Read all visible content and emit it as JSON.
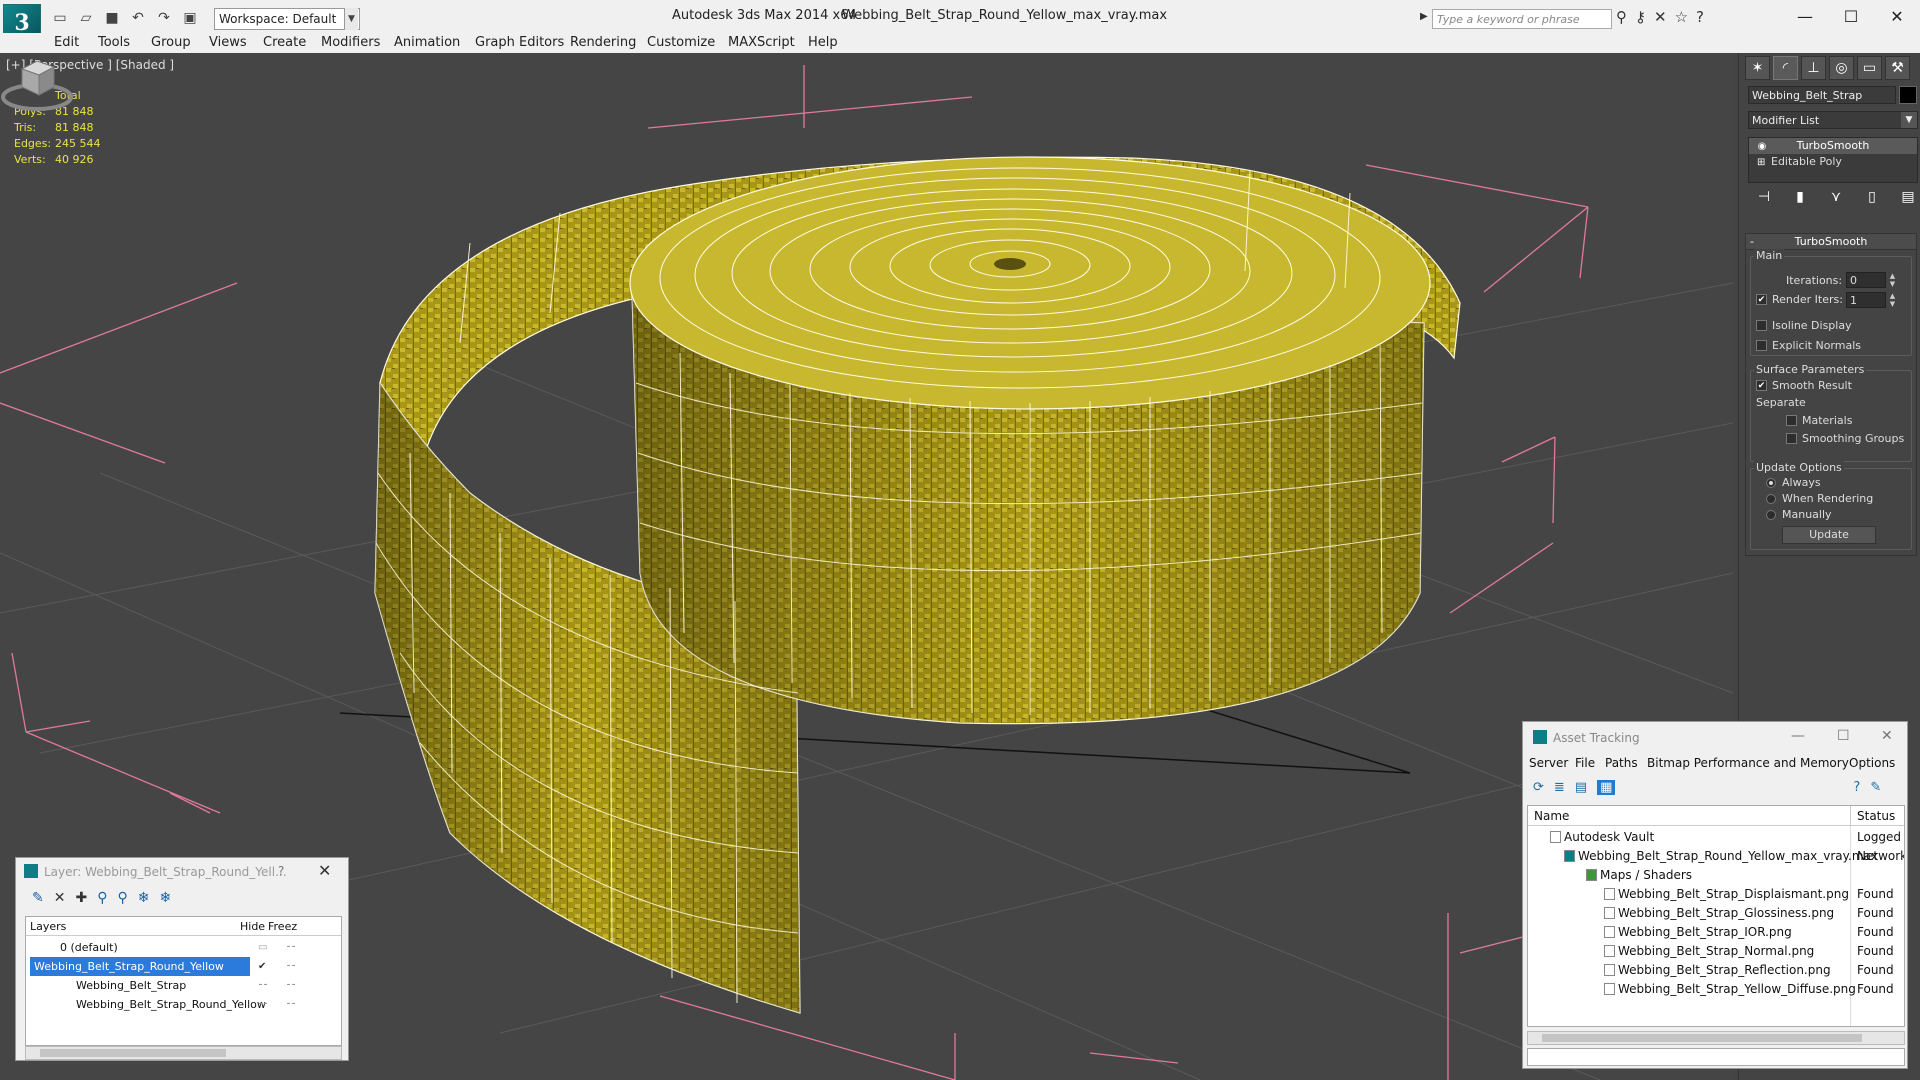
{
  "titlebar": {
    "app_title": "Autodesk 3ds Max  2014 x64",
    "file_title": "Webbing_Belt_Strap_Round_Yellow_max_vray.max",
    "workspace": "Workspace: Default",
    "search_placeholder": "Type a keyword or phrase"
  },
  "menu": [
    "Edit",
    "Tools",
    "Group",
    "Views",
    "Create",
    "Modifiers",
    "Animation",
    "Graph Editors",
    "Rendering",
    "Customize",
    "MAXScript",
    "Help"
  ],
  "viewport": {
    "label": "[+] [Perspective ] [Shaded ]",
    "stats": {
      "header": "Total",
      "rows": [
        {
          "k": "Polys:",
          "v": "81 848"
        },
        {
          "k": "Tris:",
          "v": "81 848"
        },
        {
          "k": "Edges:",
          "v": "245 544"
        },
        {
          "k": "Verts:",
          "v": "40 926"
        }
      ]
    },
    "colors": {
      "background": "#454545",
      "grid": "#5c5c5c",
      "bbox": "#e07a9a",
      "mesh": "#b5a51a",
      "wire": "#fffbe0"
    }
  },
  "command_panel": {
    "object_name": "Webbing_Belt_Strap",
    "modifier_list": "Modifier List",
    "stack": [
      "TurboSmooth",
      "Editable Poly"
    ],
    "turbosmooth": {
      "title": "TurboSmooth",
      "main_group": "Main",
      "iterations_label": "Iterations:",
      "iterations": "0",
      "render_iters_label": "Render Iters:",
      "render_iters": "1",
      "render_iters_checked": true,
      "isoline": "Isoline Display",
      "explicit_normals": "Explicit Normals",
      "surface_group": "Surface Parameters",
      "smooth_result": "Smooth Result",
      "smooth_result_checked": true,
      "separate": "Separate",
      "materials": "Materials",
      "smoothing_groups": "Smoothing Groups",
      "update_group": "Update Options",
      "always": "Always",
      "when_rendering": "When Rendering",
      "manually": "Manually",
      "update_button": "Update"
    }
  },
  "layer_window": {
    "title": "Layer: Webbing_Belt_Strap_Round_Yell...",
    "help": "?",
    "columns": [
      "Layers",
      "Hide",
      "Freez"
    ],
    "rows": [
      {
        "name": "0 (default)",
        "indent": 0,
        "selected": false
      },
      {
        "name": "Webbing_Belt_Strap_Round_Yellow",
        "indent": 0,
        "selected": true
      },
      {
        "name": "Webbing_Belt_Strap",
        "indent": 1,
        "selected": false
      },
      {
        "name": "Webbing_Belt_Strap_Round_Yellow",
        "indent": 1,
        "selected": false
      }
    ]
  },
  "asset_window": {
    "title": "Asset Tracking",
    "menu": [
      "Server",
      "File",
      "Paths",
      "Bitmap Performance and Memory",
      "Options"
    ],
    "columns": [
      "Name",
      "Status"
    ],
    "rows": [
      {
        "name": "Autodesk Vault",
        "status": "Logged O",
        "indent": 1
      },
      {
        "name": "Webbing_Belt_Strap_Round_Yellow_max_vray.max",
        "status": "Network",
        "indent": 2
      },
      {
        "name": "Maps / Shaders",
        "status": "",
        "indent": 3
      },
      {
        "name": "Webbing_Belt_Strap_Displaismant.png",
        "status": "Found",
        "indent": 4
      },
      {
        "name": "Webbing_Belt_Strap_Glossiness.png",
        "status": "Found",
        "indent": 4
      },
      {
        "name": "Webbing_Belt_Strap_IOR.png",
        "status": "Found",
        "indent": 4
      },
      {
        "name": "Webbing_Belt_Strap_Normal.png",
        "status": "Found",
        "indent": 4
      },
      {
        "name": "Webbing_Belt_Strap_Reflection.png",
        "status": "Found",
        "indent": 4
      },
      {
        "name": "Webbing_Belt_Strap_Yellow_Diffuse.png",
        "status": "Found",
        "indent": 4
      }
    ]
  }
}
